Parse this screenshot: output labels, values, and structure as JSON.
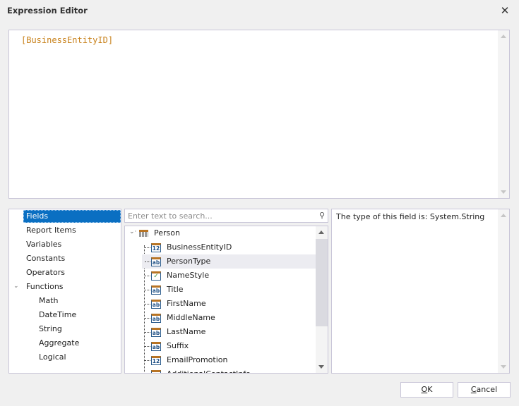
{
  "window": {
    "title": "Expression Editor",
    "close_icon": "close-icon"
  },
  "editor": {
    "expression": "[BusinessEntityID]"
  },
  "categories": {
    "items": [
      {
        "label": "Fields",
        "selected": true,
        "level": 0
      },
      {
        "label": "Report Items",
        "level": 0
      },
      {
        "label": "Variables",
        "level": 0
      },
      {
        "label": "Constants",
        "level": 0
      },
      {
        "label": "Operators",
        "level": 0
      },
      {
        "label": "Functions",
        "level": 0,
        "expanded": true
      },
      {
        "label": "Math",
        "level": 1
      },
      {
        "label": "DateTime",
        "level": 1
      },
      {
        "label": "String",
        "level": 1
      },
      {
        "label": "Aggregate",
        "level": 1
      },
      {
        "label": "Logical",
        "level": 1
      }
    ]
  },
  "search": {
    "placeholder": "Enter text to search...",
    "value": "",
    "icon": "search-icon"
  },
  "tree": {
    "root": {
      "label": "Person",
      "icon": "table-icon",
      "expanded": true
    },
    "fields": [
      {
        "label": "BusinessEntityID",
        "type": "number",
        "glyph": "12"
      },
      {
        "label": "PersonType",
        "type": "string",
        "glyph": "ab",
        "highlighted": true
      },
      {
        "label": "NameStyle",
        "type": "boolean",
        "glyph": "✓"
      },
      {
        "label": "Title",
        "type": "string",
        "glyph": "ab"
      },
      {
        "label": "FirstName",
        "type": "string",
        "glyph": "ab"
      },
      {
        "label": "MiddleName",
        "type": "string",
        "glyph": "ab"
      },
      {
        "label": "LastName",
        "type": "string",
        "glyph": "ab"
      },
      {
        "label": "Suffix",
        "type": "string",
        "glyph": "ab"
      },
      {
        "label": "EmailPromotion",
        "type": "number",
        "glyph": "12"
      },
      {
        "label": "AdditionalContactInfo",
        "type": "string",
        "glyph": "ab"
      }
    ]
  },
  "description": {
    "text": "The type of this field is: System.String"
  },
  "buttons": {
    "ok": {
      "mnemonic": "O",
      "rest": "K"
    },
    "cancel": {
      "mnemonic": "C",
      "rest": "ancel"
    }
  }
}
